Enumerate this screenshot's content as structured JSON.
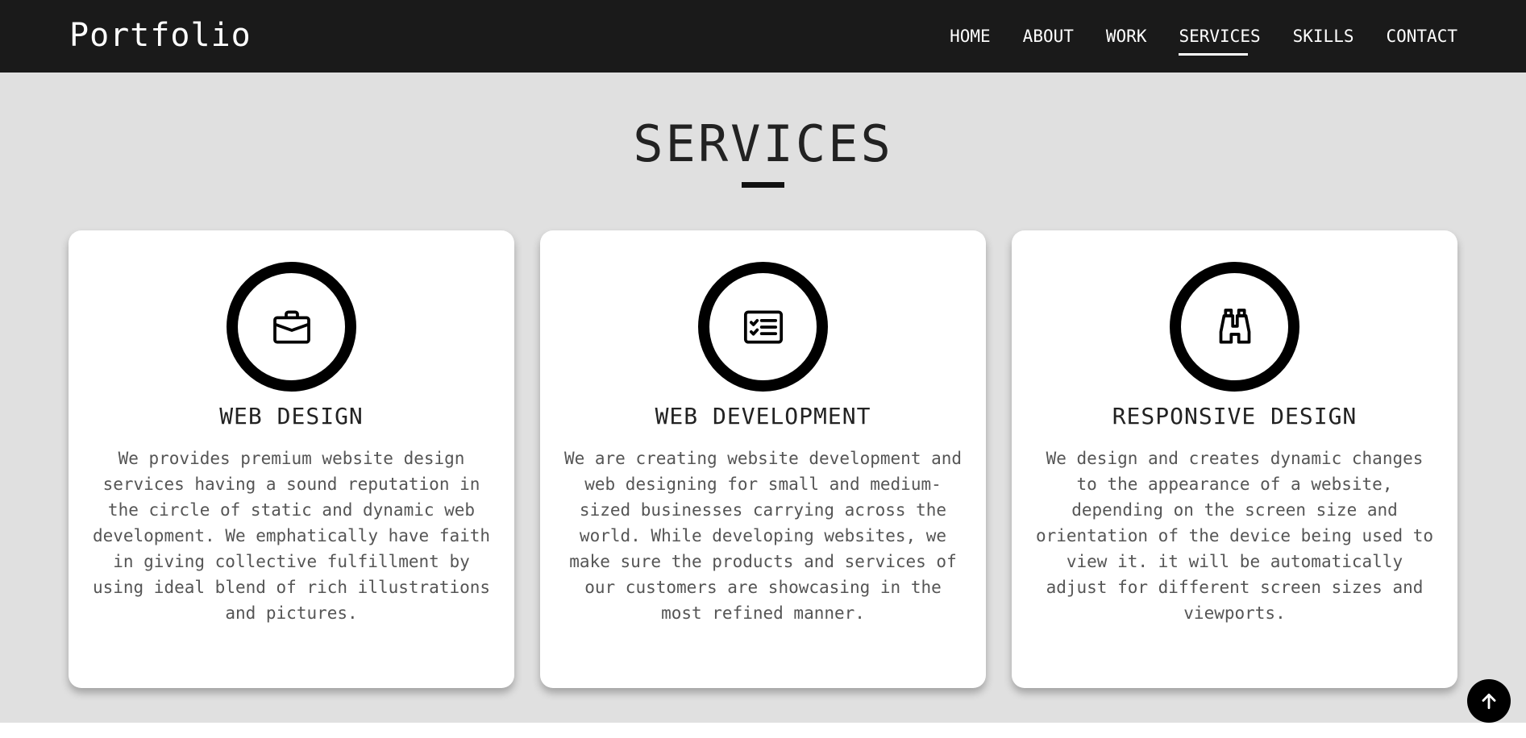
{
  "header": {
    "brand": "Portfolio",
    "nav": [
      {
        "label": "HOME"
      },
      {
        "label": "ABOUT"
      },
      {
        "label": "WORK"
      },
      {
        "label": "SERVICES",
        "active": true
      },
      {
        "label": "SKILLS"
      },
      {
        "label": "CONTACT"
      }
    ]
  },
  "services": {
    "title": "SERVICES",
    "cards": [
      {
        "icon": "briefcase-icon",
        "title": "WEB DESIGN",
        "text": "We provides premium website design services having a sound reputation in the circle of static and dynamic web development. We emphatically have faith in giving collective fulfillment by using ideal blend of rich illustrations and pictures."
      },
      {
        "icon": "checklist-icon",
        "title": "WEB DEVELOPMENT",
        "text": "We are creating website development and web designing for small and medium-sized businesses carrying across the world. While developing websites, we make sure the products and services of our customers are showcasing in the most refined manner."
      },
      {
        "icon": "binoculars-icon",
        "title": "RESPONSIVE DESIGN",
        "text": "We design and creates dynamic changes to the appearance of a website, depending on the screen size and orientation of the device being used to view it. it will be automatically adjust for different screen sizes and viewports."
      }
    ]
  },
  "back_to_top": {
    "icon": "arrow-up-icon"
  },
  "colors": {
    "header_bg": "#1a1a1a",
    "section_bg": "#e0e0e0",
    "card_bg": "#ffffff",
    "accent": "#000000"
  }
}
